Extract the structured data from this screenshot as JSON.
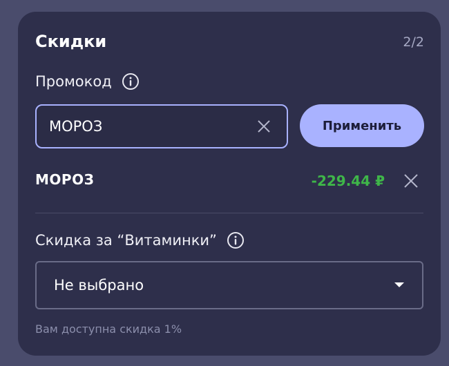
{
  "discounts": {
    "title": "Скидки",
    "step": "2/2",
    "promo": {
      "label": "Промокод",
      "input_value": "МОРОЗ",
      "apply_label": "Применить"
    },
    "applied": {
      "code": "МОРОЗ",
      "amount": "-229.44 ₽",
      "amount_color": "#3fb649"
    },
    "vitamins": {
      "label": "Скидка за “Витаминки”",
      "selected": "Не выбрано",
      "hint": "Вам доступна скидка 1%"
    },
    "colors": {
      "background": "#4a4c6c",
      "card": "#2e2f4b",
      "accent": "#a9b2ff"
    },
    "icons": {
      "info": "info-icon",
      "clear": "close-icon",
      "remove": "close-icon",
      "dropdown": "caret-down-icon"
    }
  }
}
